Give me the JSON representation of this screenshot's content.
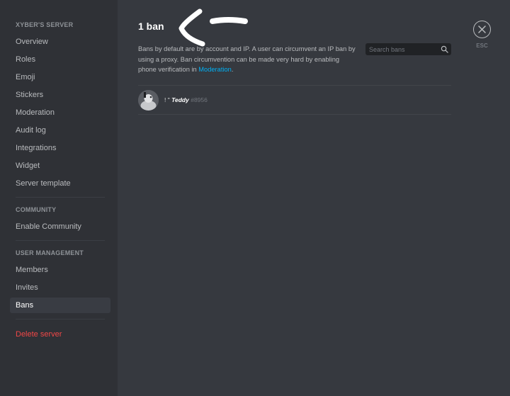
{
  "sidebar": {
    "server_header": "XYBER'S SERVER",
    "server_items": [
      {
        "label": "Overview"
      },
      {
        "label": "Roles"
      },
      {
        "label": "Emoji"
      },
      {
        "label": "Stickers"
      },
      {
        "label": "Moderation"
      },
      {
        "label": "Audit log"
      },
      {
        "label": "Integrations"
      },
      {
        "label": "Widget"
      },
      {
        "label": "Server template"
      }
    ],
    "community_header": "COMMUNITY",
    "community_items": [
      {
        "label": "Enable Community"
      }
    ],
    "user_mgmt_header": "USER MANAGEMENT",
    "user_mgmt_items": [
      {
        "label": "Members"
      },
      {
        "label": "Invites"
      },
      {
        "label": "Bans",
        "active": true
      }
    ],
    "delete_label": "Delete server"
  },
  "main": {
    "title": "1 ban",
    "description": "Bans by default are by account and IP. A user can circumvent an IP ban by using a proxy. Ban circumvention can be made very hard by enabling phone verification in",
    "description_link": "Moderation",
    "description_end": ".",
    "search_placeholder": "Search bans",
    "bans": [
      {
        "prefix": "! \"",
        "username": "Teddy",
        "discriminator": "#8956"
      }
    ]
  },
  "close": {
    "esc_label": "ESC"
  },
  "colors": {
    "background": "#36393f",
    "sidebar": "#2f3136",
    "danger": "#f04747",
    "link": "#00b0f4"
  },
  "icons": {
    "search": "search-icon",
    "close": "close-icon",
    "annotation": "arrow-annotation"
  }
}
